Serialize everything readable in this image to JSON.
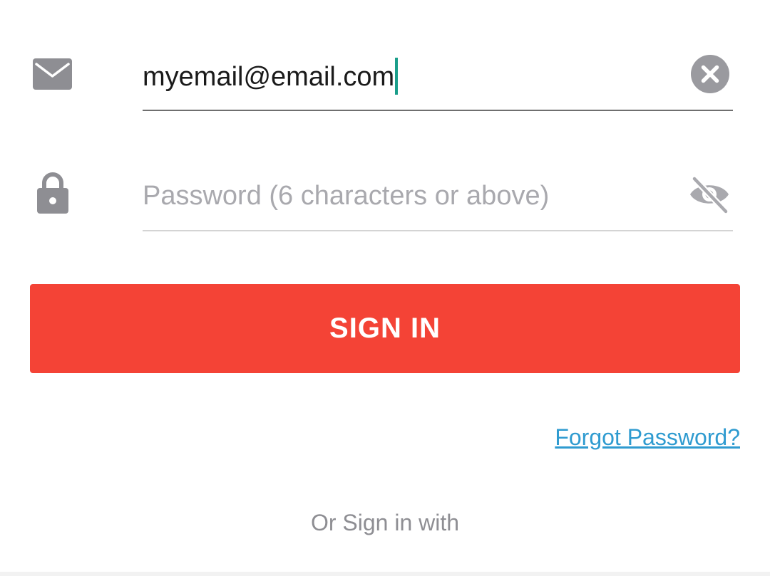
{
  "colors": {
    "icon_gray": "#8e8e93",
    "accent_caret": "#1a9e8a",
    "underline_active": "#6f6f6f",
    "underline_idle": "#d4d4d4",
    "signin_bg": "#f44336",
    "link_blue": "#2f9bd0"
  },
  "email": {
    "icon": "envelope-icon",
    "value": "myemail@email.com",
    "clear_icon": "clear-circle-x-icon"
  },
  "password": {
    "icon": "lock-icon",
    "placeholder": "Password (6 characters or above)",
    "visibility_icon": "eye-off-icon"
  },
  "signin": {
    "label": "SIGN IN"
  },
  "forgot_password": {
    "label": "Forgot Password?"
  },
  "alternate": {
    "label": "Or Sign in with"
  }
}
